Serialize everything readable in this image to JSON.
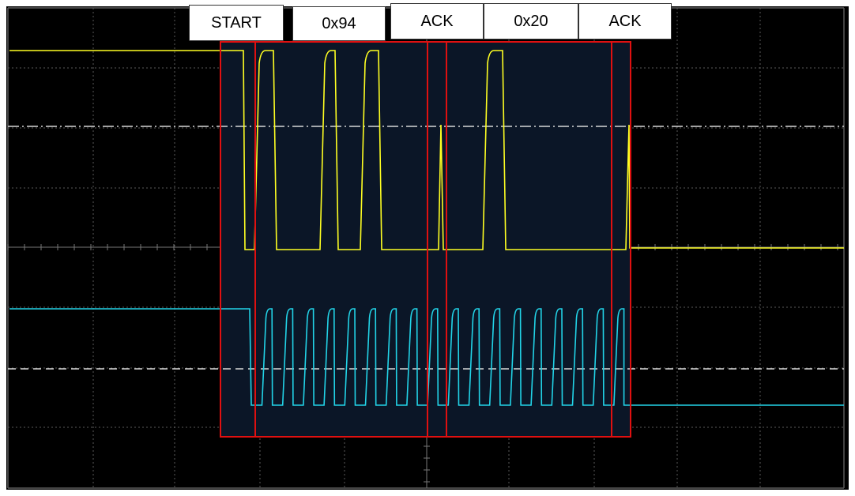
{
  "colors": {
    "background": "#000000",
    "grid": "#5a5a5a",
    "ref_line": "#d8d8d8",
    "sda_trace": "#ffff22",
    "scl_trace": "#22d4e8",
    "frame_box": "#e01010",
    "label_bg": "#ffffff",
    "label_text": "#000000"
  },
  "labels": {
    "start": "START",
    "byte1": "0x94",
    "ack1": "ACK",
    "byte2": "0x20",
    "ack2": "ACK"
  },
  "chart_data": {
    "type": "line",
    "title": "",
    "xlabel": "",
    "ylabel": "",
    "grid": true,
    "series": [
      {
        "name": "",
        "values": [
          1,
          1,
          0,
          0,
          1,
          0,
          0,
          1,
          0,
          1,
          0,
          0,
          0,
          0,
          1,
          0,
          0,
          0,
          0,
          0,
          1,
          1,
          1
        ]
      },
      {
        "name": "",
        "values": [
          1,
          1,
          0,
          1,
          0,
          1,
          0,
          1,
          0,
          1,
          0,
          1,
          0,
          1,
          0,
          1,
          0,
          1,
          0,
          1,
          0,
          1,
          0
        ]
      }
    ]
  }
}
